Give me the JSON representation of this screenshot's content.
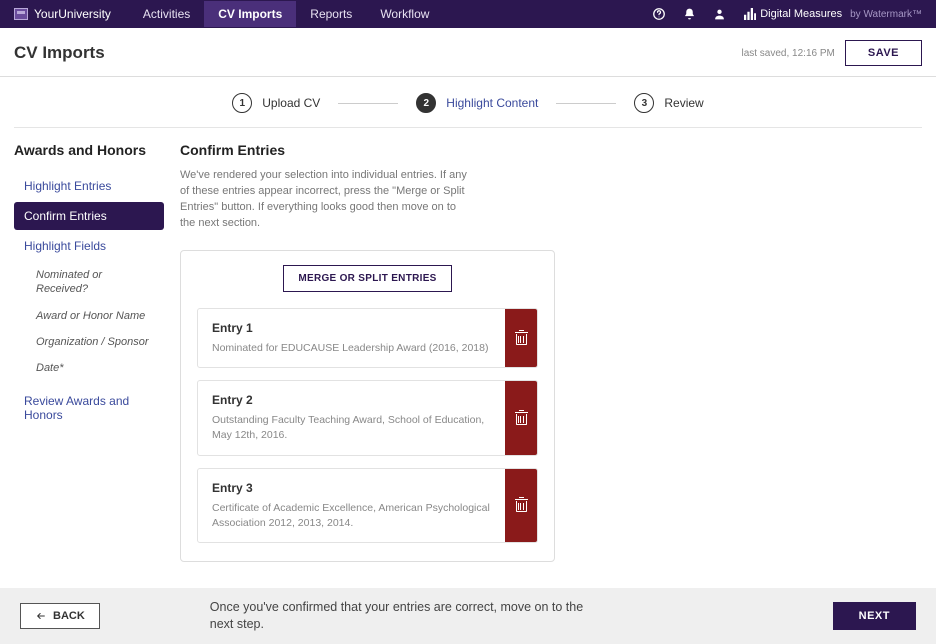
{
  "topnav": {
    "brand": "YourUniversity",
    "items": [
      "Activities",
      "CV Imports",
      "Reports",
      "Workflow"
    ],
    "active_index": 1,
    "dm_label": "Digital Measures",
    "dm_by": "by Watermark™"
  },
  "titlebar": {
    "title": "CV Imports",
    "last_saved": "last saved, 12:16 PM",
    "save_label": "SAVE"
  },
  "stepper": {
    "steps": [
      {
        "num": "1",
        "label": "Upload CV"
      },
      {
        "num": "2",
        "label": "Highlight Content"
      },
      {
        "num": "3",
        "label": "Review"
      }
    ],
    "active_index": 1
  },
  "sidebar": {
    "heading": "Awards and Honors",
    "items": [
      {
        "label": "Highlight Entries"
      },
      {
        "label": "Confirm Entries",
        "selected": true
      },
      {
        "label": "Highlight Fields"
      }
    ],
    "sub_items": [
      "Nominated or Received?",
      "Award or Honor Name",
      "Organization / Sponsor",
      "Date*"
    ],
    "review_label": "Review Awards and Honors"
  },
  "main": {
    "heading": "Confirm Entries",
    "intro": "We've rendered your selection into individual entries. If any of these entries appear incorrect, press the \"Merge or Split Entries\" button. If everything looks good then move on to the next section.",
    "mos_label": "MERGE OR SPLIT ENTRIES",
    "entries": [
      {
        "title": "Entry 1",
        "desc": "Nominated for EDUCAUSE Leadership Award (2016, 2018)"
      },
      {
        "title": "Entry 2",
        "desc": "Outstanding Faculty Teaching Award, School of Education, May 12th, 2016."
      },
      {
        "title": "Entry 3",
        "desc": "Certificate of Academic Excellence, American Psychological Association 2012, 2013, 2014."
      }
    ]
  },
  "footer": {
    "back_label": "BACK",
    "hint": "Once you've confirmed that your entries are correct, move on to the next step.",
    "next_label": "NEXT"
  }
}
